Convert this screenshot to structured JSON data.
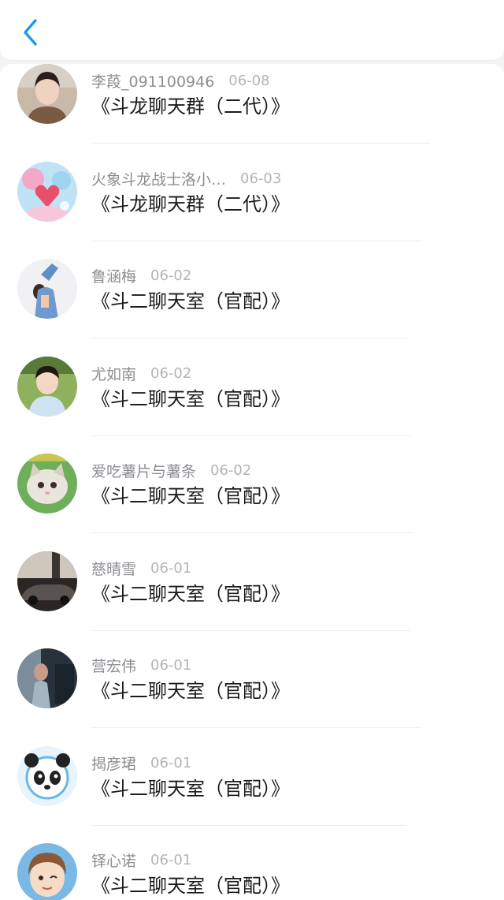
{
  "nav": {
    "back_icon": "chevron-left-icon",
    "accent": "#1a9be8"
  },
  "items": [
    {
      "name": "李葮_091100946",
      "date": "06-08",
      "group": "《斗龙聊天群（二代）》"
    },
    {
      "name": "火象斗龙战士洛小…",
      "date": "06-03",
      "group": "《斗龙聊天群（二代）》"
    },
    {
      "name": "鲁涵梅",
      "date": "06-02",
      "group": "《斗二聊天室（官配）》"
    },
    {
      "name": "尤如南",
      "date": "06-02",
      "group": "《斗二聊天室（官配）》"
    },
    {
      "name": "爱吃薯片与薯条",
      "date": "06-02",
      "group": "《斗二聊天室（官配）》"
    },
    {
      "name": "慈晴雪",
      "date": "06-01",
      "group": "《斗二聊天室（官配）》"
    },
    {
      "name": "营宏伟",
      "date": "06-01",
      "group": "《斗二聊天室（官配）》"
    },
    {
      "name": "揭彦珺",
      "date": "06-01",
      "group": "《斗二聊天室（官配）》"
    },
    {
      "name": "铎心诺",
      "date": "06-01",
      "group": "《斗二聊天室（官配）》"
    }
  ]
}
